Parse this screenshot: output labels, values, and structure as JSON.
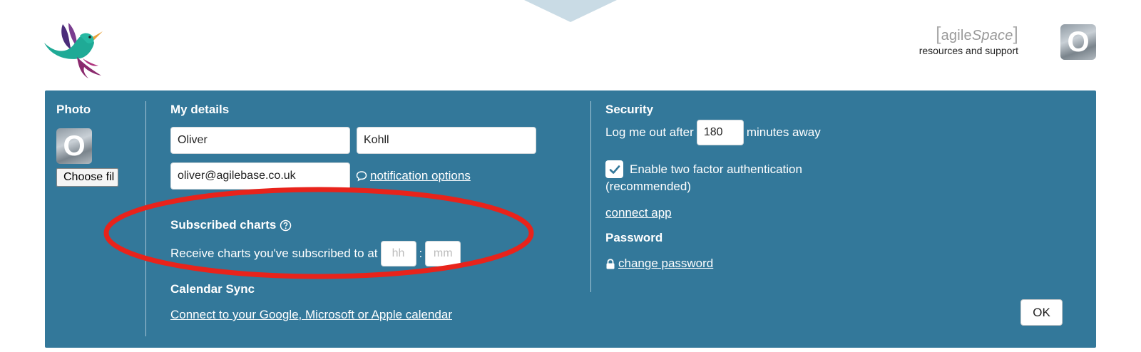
{
  "header": {
    "brand_open_bracket": "[",
    "brand_word1": "agile",
    "brand_word2": "Space",
    "brand_close_bracket": "]",
    "brand_subtitle": "resources and support",
    "user_initial": "O"
  },
  "photo": {
    "heading": "Photo",
    "initial": "O",
    "choose_file_label": "Choose fil"
  },
  "details": {
    "heading": "My details",
    "first_name": "Oliver",
    "last_name": "Kohll",
    "email": "oliver@agilebase.co.uk",
    "notification_link": "notification options"
  },
  "subscribed": {
    "heading": "Subscribed charts",
    "receive_text": "Receive charts you've subscribed to at",
    "hours_placeholder": "hh",
    "separator": ":",
    "minutes_placeholder": "mm"
  },
  "calendar": {
    "heading": "Calendar Sync",
    "link": "Connect to your Google, Microsoft or Apple calendar"
  },
  "security": {
    "heading": "Security",
    "logout_prefix": "Log me out after",
    "logout_minutes": "180",
    "logout_suffix": "minutes away",
    "two_factor_label": "Enable two factor authentication",
    "two_factor_note": "(recommended)",
    "two_factor_checked": true,
    "connect_app_link": "connect app",
    "password_heading": "Password",
    "change_password_link": "change password"
  },
  "actions": {
    "ok_label": "OK"
  },
  "colors": {
    "panel": "#33789a",
    "annotation": "#e8231b"
  }
}
